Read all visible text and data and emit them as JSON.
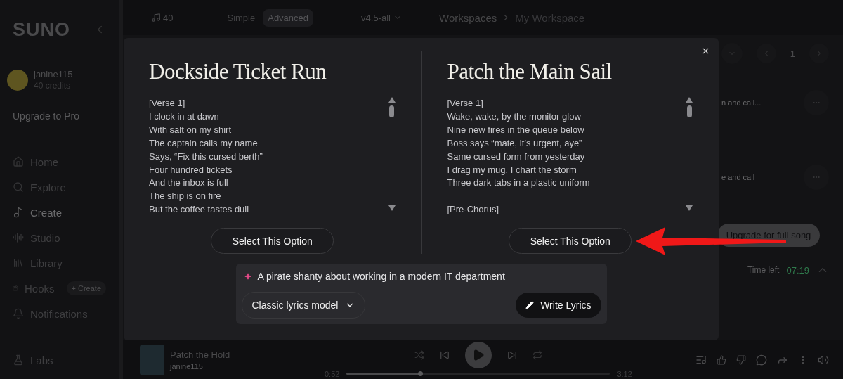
{
  "sidebar": {
    "logo": "SUNO",
    "user": {
      "name": "janine115",
      "credits": "40 credits"
    },
    "upgrade": "Upgrade to Pro",
    "items": [
      {
        "kind": "home",
        "label": "Home",
        "selected": false
      },
      {
        "kind": "explore",
        "label": "Explore",
        "selected": false
      },
      {
        "kind": "create",
        "label": "Create",
        "selected": true
      },
      {
        "kind": "studio",
        "label": "Studio",
        "selected": false
      },
      {
        "kind": "library",
        "label": "Library",
        "selected": false
      },
      {
        "kind": "hooks",
        "label": "Hooks",
        "selected": false,
        "action": "+ Create"
      },
      {
        "kind": "notifications",
        "label": "Notifications",
        "selected": false
      }
    ],
    "footer_item": {
      "kind": "labs",
      "label": "Labs"
    }
  },
  "topbar": {
    "credits": "40",
    "modes": [
      {
        "label": "Simple",
        "selected": false
      },
      {
        "label": "Advanced",
        "selected": true
      }
    ],
    "model": "v4.5-all",
    "breadcrumb": [
      "Workspaces",
      "My Workspace"
    ]
  },
  "background": {
    "page": "1",
    "rows": [
      "n and call...",
      "e and call"
    ],
    "upgrade": "Upgrade for full song",
    "time_label": "Time left",
    "time": "07:19"
  },
  "modal": {
    "options": [
      {
        "title": "Dockside Ticket Run",
        "stanzas": [
          [
            "[Verse 1]",
            "I clock in at dawn",
            "With salt on my shirt",
            "The captain calls my name",
            "Says, “Fix this cursed berth”",
            "Four hundred tickets",
            "And the inbox is full",
            "The ship is on fire",
            "But the coffee tastes dull"
          ]
        ],
        "button": "Select This Option"
      },
      {
        "title": "Patch the Main Sail",
        "stanzas": [
          [
            "[Verse 1]",
            "Wake, wake, by the monitor glow",
            "Nine new fires in the queue below",
            "Boss says “mate, it’s urgent, aye”",
            "Same cursed form from yesterday",
            "I drag my mug, I chart the storm",
            "Three dark tabs in a plastic uniform"
          ],
          [
            "[Pre-Chorus]"
          ]
        ],
        "button": "Select This Option"
      }
    ],
    "prompt": "A pirate shanty about working in a modern IT department",
    "model_select": "Classic lyrics model",
    "write_button": "Write Lyrics"
  },
  "player": {
    "title": "Patch the Hold",
    "artist": "janine115",
    "elapsed": "0:52",
    "duration": "3:12",
    "level": 0.28
  }
}
